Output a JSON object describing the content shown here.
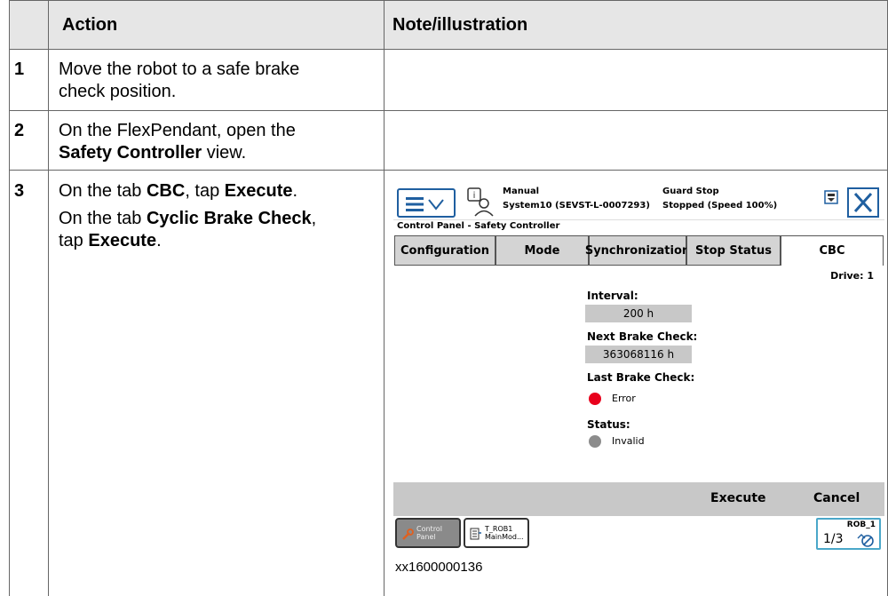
{
  "table": {
    "headers": {
      "num": "",
      "action": "Action",
      "note": "Note/illustration"
    },
    "rows": [
      {
        "num": "1",
        "action_line1": "Move the robot to a safe brake",
        "action_line2": "check position."
      },
      {
        "num": "2",
        "action_line1": "On the FlexPendant, open the",
        "action_line2_bold": "Safety Controller",
        "action_line2_rest": " view."
      },
      {
        "num": "3",
        "line1_pre": "On the tab ",
        "line1_b1": "CBC",
        "line1_mid": ", tap ",
        "line1_b2": "Execute",
        "line1_end": ".",
        "line2_pre": "On the tab ",
        "line2_b1": "Cyclic Brake Check",
        "line2_end": ",",
        "line3_pre": "tap ",
        "line3_b1": "Execute",
        "line3_end": "."
      }
    ]
  },
  "flexpendant": {
    "status": {
      "mode": "Manual",
      "system": "System10 (SEVST-L-0007293)",
      "guard": "Guard Stop",
      "speed": "Stopped (Speed 100%)"
    },
    "title": "Control Panel - Safety Controller",
    "tabs": [
      "Configuration",
      "Mode",
      "Synchronization",
      "Stop Status",
      "CBC"
    ],
    "active_tab": "CBC",
    "drive": "Drive: 1",
    "interval_label": "Interval:",
    "interval_value": "200 h",
    "next_label": "Next Brake Check:",
    "next_value": "363068116 h",
    "last_label": "Last Brake Check:",
    "last_value": "Error",
    "status_label": "Status:",
    "status_value": "Invalid",
    "colors": {
      "error": "#e8001c",
      "invalid": "#8c8c8c",
      "accent": "#1f5fa0"
    },
    "buttons": {
      "execute": "Execute",
      "cancel": "Cancel"
    },
    "taskbar": {
      "control_panel_1": "Control",
      "control_panel_2": "Panel",
      "task_1": "T_ROB1",
      "task_2": "MainMod...",
      "rob": "ROB_1",
      "rob_fraction": "1/3"
    }
  },
  "caption": "xx1600000136"
}
